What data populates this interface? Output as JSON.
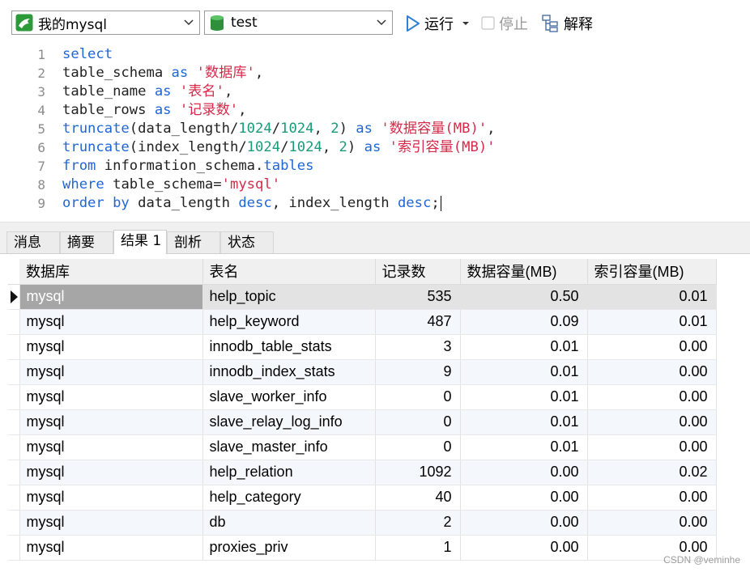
{
  "toolbar": {
    "connection": "我的mysql",
    "database": "test",
    "run_label": "运行",
    "stop_label": "停止",
    "explain_label": "解释"
  },
  "editor": {
    "line_numbers": [
      "1",
      "2",
      "3",
      "4",
      "5",
      "6",
      "7",
      "8",
      "9"
    ],
    "lines": [
      [
        {
          "t": "select",
          "c": "kw"
        }
      ],
      [
        {
          "t": "table_schema ",
          "c": "pl"
        },
        {
          "t": "as",
          "c": "kw"
        },
        {
          "t": " ",
          "c": "pl"
        },
        {
          "t": "'数据库'",
          "c": "st"
        },
        {
          "t": ",",
          "c": "pl"
        }
      ],
      [
        {
          "t": "table_name ",
          "c": "pl"
        },
        {
          "t": "as",
          "c": "kw"
        },
        {
          "t": " ",
          "c": "pl"
        },
        {
          "t": "'表名'",
          "c": "st"
        },
        {
          "t": ",",
          "c": "pl"
        }
      ],
      [
        {
          "t": "table_rows ",
          "c": "pl"
        },
        {
          "t": "as",
          "c": "kw"
        },
        {
          "t": " ",
          "c": "pl"
        },
        {
          "t": "'记录数'",
          "c": "st"
        },
        {
          "t": ",",
          "c": "pl"
        }
      ],
      [
        {
          "t": "truncate",
          "c": "kw"
        },
        {
          "t": "(data_length/",
          "c": "pl"
        },
        {
          "t": "1024",
          "c": "nm"
        },
        {
          "t": "/",
          "c": "pl"
        },
        {
          "t": "1024",
          "c": "nm"
        },
        {
          "t": ", ",
          "c": "pl"
        },
        {
          "t": "2",
          "c": "nm"
        },
        {
          "t": ") ",
          "c": "pl"
        },
        {
          "t": "as",
          "c": "kw"
        },
        {
          "t": " ",
          "c": "pl"
        },
        {
          "t": "'数据容量(MB)'",
          "c": "st"
        },
        {
          "t": ",",
          "c": "pl"
        }
      ],
      [
        {
          "t": "truncate",
          "c": "kw"
        },
        {
          "t": "(index_length/",
          "c": "pl"
        },
        {
          "t": "1024",
          "c": "nm"
        },
        {
          "t": "/",
          "c": "pl"
        },
        {
          "t": "1024",
          "c": "nm"
        },
        {
          "t": ", ",
          "c": "pl"
        },
        {
          "t": "2",
          "c": "nm"
        },
        {
          "t": ") ",
          "c": "pl"
        },
        {
          "t": "as",
          "c": "kw"
        },
        {
          "t": " ",
          "c": "pl"
        },
        {
          "t": "'索引容量(MB)'",
          "c": "st"
        }
      ],
      [
        {
          "t": "from",
          "c": "kw"
        },
        {
          "t": " information_schema.",
          "c": "pl"
        },
        {
          "t": "tables",
          "c": "kw"
        }
      ],
      [
        {
          "t": "where",
          "c": "kw"
        },
        {
          "t": " table_schema=",
          "c": "pl"
        },
        {
          "t": "'mysql'",
          "c": "st"
        }
      ],
      [
        {
          "t": "order by",
          "c": "kw"
        },
        {
          "t": " data_length ",
          "c": "pl"
        },
        {
          "t": "desc",
          "c": "kw"
        },
        {
          "t": ", index_length ",
          "c": "pl"
        },
        {
          "t": "desc",
          "c": "kw"
        },
        {
          "t": ";",
          "c": "pl"
        }
      ]
    ]
  },
  "tabs": [
    "消息",
    "摘要",
    "结果 1",
    "剖析",
    "状态"
  ],
  "active_tab": 2,
  "table": {
    "columns": [
      "数据库",
      "表名",
      "记录数",
      "数据容量(MB)",
      "索引容量(MB)"
    ],
    "rows": [
      [
        "mysql",
        "help_topic",
        "535",
        "0.50",
        "0.01"
      ],
      [
        "mysql",
        "help_keyword",
        "487",
        "0.09",
        "0.01"
      ],
      [
        "mysql",
        "innodb_table_stats",
        "3",
        "0.01",
        "0.00"
      ],
      [
        "mysql",
        "innodb_index_stats",
        "9",
        "0.01",
        "0.00"
      ],
      [
        "mysql",
        "slave_worker_info",
        "0",
        "0.01",
        "0.00"
      ],
      [
        "mysql",
        "slave_relay_log_info",
        "0",
        "0.01",
        "0.00"
      ],
      [
        "mysql",
        "slave_master_info",
        "0",
        "0.01",
        "0.00"
      ],
      [
        "mysql",
        "help_relation",
        "1092",
        "0.00",
        "0.02"
      ],
      [
        "mysql",
        "help_category",
        "40",
        "0.00",
        "0.00"
      ],
      [
        "mysql",
        "db",
        "2",
        "0.00",
        "0.00"
      ],
      [
        "mysql",
        "proxies_priv",
        "1",
        "0.00",
        "0.00"
      ]
    ],
    "selected_row": 0
  },
  "watermark": "CSDN @veminhe",
  "colors": {
    "keyword": "#1f66d6",
    "string": "#d62a4a",
    "number": "#1a9a7a",
    "run_icon": "#2f7fd6"
  },
  "icons": [
    "mysql-connection-icon",
    "database-icon",
    "chevron-down-icon",
    "run-icon",
    "stop-checkbox-icon",
    "explain-icon",
    "row-indicator-arrow-icon"
  ]
}
